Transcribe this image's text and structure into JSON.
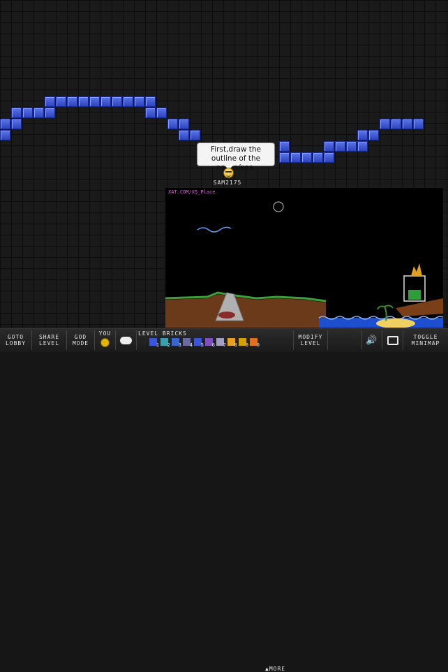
{
  "chat": {
    "message": "First,draw the outline of the ocean/sea."
  },
  "player": {
    "username": "SAM2175"
  },
  "minimap": {
    "title": "XAT.COM/X5_Place"
  },
  "toolbar": {
    "goto_lobby": [
      "GOTO",
      "LOBBY"
    ],
    "share_level": [
      "SHARE",
      "LEVEL"
    ],
    "god_mode": [
      "GOD",
      "MODE"
    ],
    "you": "YOU",
    "level_bricks": "LEVEL BRICKS",
    "more": "▲MORE",
    "modify_level": [
      "MODIFY",
      "LEVEL"
    ],
    "toggle_minimap": [
      "TOGGLE",
      "MINIMAP"
    ],
    "brick_numbers": [
      "1",
      "2",
      "3",
      "4",
      "5",
      "6",
      "7",
      "8",
      "9",
      "0"
    ]
  },
  "colors": {
    "brick_blue": "#3a55d6",
    "bubble_bg": "#f4f4f4",
    "background": "#1a1a1a",
    "minimap_title": "#e060e0"
  }
}
